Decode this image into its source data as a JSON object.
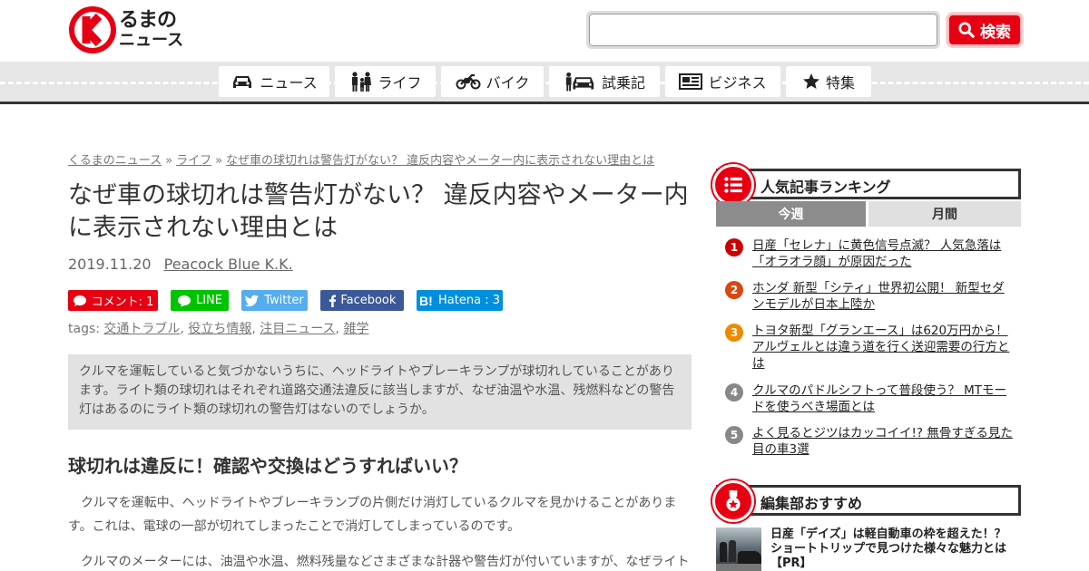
{
  "header": {
    "logo_line1": "るまの",
    "logo_line2": "ニュース",
    "search_placeholder": "",
    "search_button": "検索"
  },
  "nav": {
    "items": [
      {
        "label": "ニュース",
        "icon": "car-icon"
      },
      {
        "label": "ライフ",
        "icon": "family-icon"
      },
      {
        "label": "バイク",
        "icon": "motorcycle-icon"
      },
      {
        "label": "試乗記",
        "icon": "test-drive-icon"
      },
      {
        "label": "ビジネス",
        "icon": "newspaper-icon"
      },
      {
        "label": "特集",
        "icon": "star-icon"
      }
    ]
  },
  "breadcrumb": {
    "home": "くるまのニュース",
    "sep": "»",
    "category": "ライフ",
    "current": "なぜ車の球切れは警告灯がない？ 違反内容やメーター内に表示されない理由とは"
  },
  "article": {
    "title": "なぜ車の球切れは警告灯がない？ 違反内容やメーター内に表示されない理由とは",
    "date": "2019.11.20",
    "author": "Peacock Blue K.K.",
    "share": {
      "comment": "コメント: 1",
      "line": "LINE",
      "twitter": "Twitter",
      "facebook": "Facebook",
      "hatena": "Hatena : 3"
    },
    "tags_label": "tags:",
    "tags": [
      "交通トラブル",
      "役立ち情報",
      "注目ニュース",
      "雑学"
    ],
    "lead": "クルマを運転していると気づかないうちに、ヘッドライトやブレーキランプが球切れしていることがあります。ライト類の球切れはそれぞれ道路交通法違反に該当しますが、なぜ油温や水温、残燃料などの警告灯はあるのにライト類の球切れの警告灯はないのでしょうか。",
    "heading": "球切れは違反に！確認や交換はどうすればいい？",
    "para1": "クルマを運転中、ヘッドライトやブレーキランプの片側だけ消灯しているクルマを見かけることがあります。これは、電球の一部が切れてしまったことで消灯してしまっているのです。",
    "para2": "クルマのメーターには、油温や水温、燃料残量などさまざまな計器や警告灯が付いていますが、なぜライト"
  },
  "sidebar": {
    "ranking_title": "人気記事ランキング",
    "tab_week": "今週",
    "tab_month": "月間",
    "ranking": [
      {
        "num": "1",
        "text": "日産「セレナ」に黄色信号点滅？ 人気急落は「オラオラ顔」が原因だった",
        "color": "#cc0000"
      },
      {
        "num": "2",
        "text": "ホンダ 新型「シティ」世界初公開！ 新型セダンモデルが日本上陸か",
        "color": "#d9480f"
      },
      {
        "num": "3",
        "text": "トヨタ新型「グランエース」は620万円から！ アルヴェルとは違う道を行く送迎需要の行方とは",
        "color": "#ef8a00"
      },
      {
        "num": "4",
        "text": "クルマのパドルシフトって普段使う？ MTモードを使うべき場面とは",
        "color": "#888888"
      },
      {
        "num": "5",
        "text": "よく見るとジツはカッコイイ!? 無骨すぎる見た目の車3選",
        "color": "#888888"
      }
    ],
    "recommend_title": "編集部おすすめ",
    "recommend": {
      "text": "日産「デイズ」は軽自動車の枠を超えた！？ ショートトリップで見つけた様々な魅力とは【PR】"
    }
  },
  "colors": {
    "brand_red": "#e60012",
    "line_green": "#00c300",
    "twitter_blue": "#55acee",
    "facebook_blue": "#3b5998",
    "hatena_blue": "#008fde"
  }
}
